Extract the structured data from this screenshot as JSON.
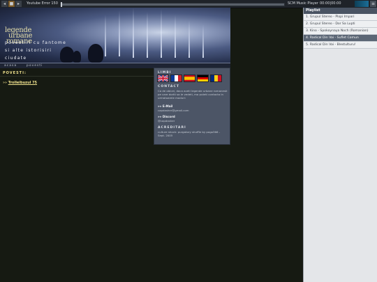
{
  "player": {
    "prev_icon": "◂",
    "play_icon": "■",
    "next_icon": "▸",
    "track_title": "Youtube Error 150",
    "seek_progress": 0,
    "player_name": "SCM Music Player",
    "time": "00:00|00:00",
    "menu_icon": "≡"
  },
  "playlist": {
    "title": "Playlist",
    "items": [
      "1. Grupul Stereo - Plopi Impari",
      "2. Grupul Stereo - Dor Sa Lupti",
      "3. Kino - Spokoynaya Noch (Romanian)",
      "4. Radical Din Vai - Suflet Comun",
      "5. Radical Din Vai - Blestulturu!"
    ],
    "active_index": 3
  },
  "header": {
    "logo_line1": "legende",
    "logo_line2": "urbane",
    "logo_line3": "romane",
    "tagline1": "povestiri cu fantome",
    "tagline2": "si alte istorisiri",
    "tagline3": "ciudate",
    "nav": [
      "acasa",
      "povesti"
    ]
  },
  "content": {
    "section_title": "POVESTI:",
    "stories": [
      {
        "bullet": "»»",
        "title": "Trolleibuzul 75"
      }
    ]
  },
  "info": {
    "languages_title": "LIMBI",
    "languages": [
      "en",
      "fr",
      "es",
      "de",
      "ro"
    ],
    "contact_title": "CONTACT",
    "contact_text": "Ca de obicei, daca aveti legende urbane romanesti pe care doriti sa le vedeti, ma puteti contacta in urmatoarele moduri:",
    "email_label": "»» E-Mail",
    "email_value": "capdasher@gmail.com",
    "discord_label": "»» Discord",
    "discord_value": "@capdasher",
    "credits_title": "ACREDITARI",
    "credits_text": "culture shock: purgatory shuffle by pogo366 - Sept. 2005"
  }
}
